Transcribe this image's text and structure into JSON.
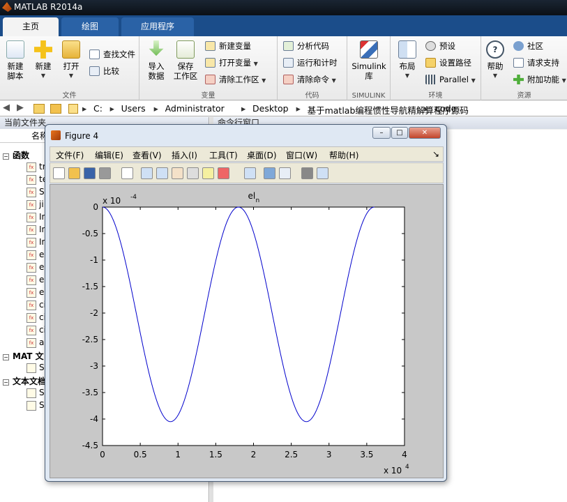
{
  "app": {
    "title": "MATLAB R2014a"
  },
  "tabs": [
    {
      "label": "主页"
    },
    {
      "label": "绘图"
    },
    {
      "label": "应用程序"
    }
  ],
  "ribbon": {
    "file": {
      "section": "文件",
      "new_script": "新建\n脚本",
      "new": "新建",
      "open": "打开",
      "find_files": "查找文件",
      "compare": "比较"
    },
    "variable": {
      "section": "变量",
      "import": "导入\n数据",
      "save_ws": "保存\n工作区",
      "new_var": "新建变量",
      "open_var": "打开变量",
      "clear_ws": "清除工作区"
    },
    "code": {
      "section": "代码",
      "analyze": "分析代码",
      "run_time": "运行和计时",
      "clear_cmd": "清除命令"
    },
    "simulink": {
      "section": "SIMULINK",
      "simulink_lib": "Simulink\n库"
    },
    "env": {
      "section": "环境",
      "layout": "布局",
      "prefs": "预设",
      "set_path": "设置路径",
      "parallel": "Parallel"
    },
    "resources": {
      "section": "资源",
      "help": "帮助",
      "community": "社区",
      "request_support": "请求支持",
      "addons": "附加功能"
    }
  },
  "address": {
    "crumbs": [
      "C:",
      "Users",
      "Administrator",
      "Desktop",
      "基于matlab编程惯性导航精解算程序源码",
      "code"
    ]
  },
  "left_panel": {
    "header": "当前文件夹",
    "col_name": "名称",
    "groups": [
      {
        "label": "函数",
        "files": [
          "tr",
          "te",
          "S",
          "ji",
          "In",
          "In",
          "In",
          "e",
          "e",
          "e",
          "e",
          "ci",
          "ci",
          "ci",
          "a"
        ]
      },
      {
        "label": "MAT 文",
        "files": [
          "S"
        ]
      },
      {
        "label": "文本文档",
        "files": [
          "S",
          "S"
        ]
      }
    ]
  },
  "cmd": {
    "header": "命令行窗口"
  },
  "figure": {
    "title": "Figure 4",
    "menu": [
      "文件(F)",
      "编辑(E)",
      "查看(V)",
      "插入(I)",
      "工具(T)",
      "桌面(D)",
      "窗口(W)",
      "帮助(H)"
    ],
    "toolbar_icons": [
      "new-figure-icon",
      "open-icon",
      "save-icon",
      "print-icon",
      "pointer-icon",
      "zoom-in-icon",
      "zoom-out-icon",
      "pan-icon",
      "rotate-icon",
      "data-cursor-icon",
      "brush-icon",
      "link-icon",
      "colorbar-icon",
      "legend-icon",
      "hide-tools-icon",
      "show-tools-icon"
    ]
  },
  "chart_data": {
    "type": "line",
    "title_main": "el",
    "title_sub": "n",
    "xlabel": "",
    "ylabel": "",
    "x_exponent_label": "x 10",
    "x_exponent": "4",
    "y_exponent_label": "x 10",
    "y_exponent": "-4",
    "xlim": [
      0,
      4
    ],
    "ylim": [
      -4.5,
      0
    ],
    "xticks": [
      "0",
      "0.5",
      "1",
      "1.5",
      "2",
      "2.5",
      "3",
      "3.5",
      "4"
    ],
    "yticks": [
      "0",
      "-0.5",
      "-1",
      "-1.5",
      "-2",
      "-2.5",
      "-3",
      "-3.5",
      "-4",
      "-4.5"
    ],
    "series": [
      {
        "color": "#0000cc",
        "x_range": [
          0,
          3.6
        ],
        "model": "y = -2.025*(1 - cos(2*pi*x/1.8))",
        "x": [
          0,
          0.225,
          0.45,
          0.675,
          0.9,
          1.125,
          1.35,
          1.575,
          1.8,
          2.025,
          2.25,
          2.475,
          2.7,
          2.925,
          3.15,
          3.375,
          3.6
        ],
        "y": [
          0,
          -0.593,
          -2.025,
          -3.457,
          -4.05,
          -3.457,
          -2.025,
          -0.593,
          0,
          -0.593,
          -2.025,
          -3.457,
          -4.05,
          -3.457,
          -2.025,
          -0.593,
          0
        ]
      }
    ]
  }
}
